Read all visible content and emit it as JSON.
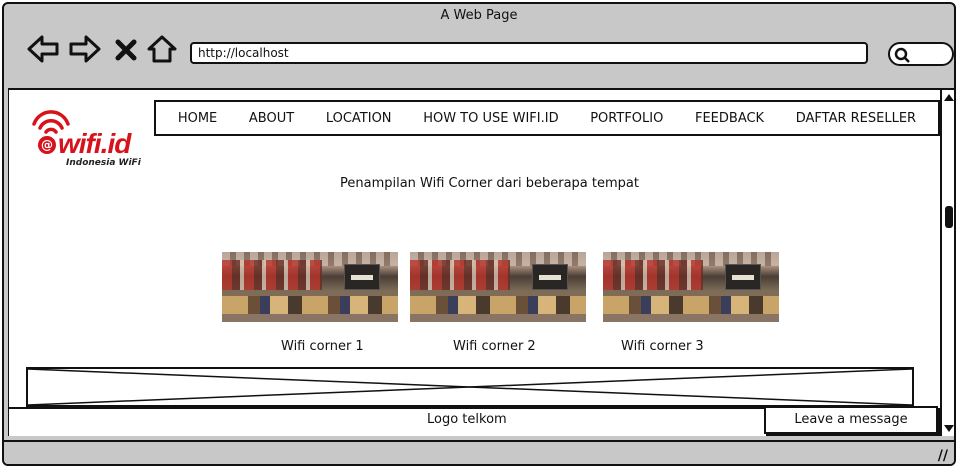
{
  "window": {
    "title": "A Web Page"
  },
  "browser": {
    "url": "http://localhost",
    "icons": [
      "back-icon",
      "forward-icon",
      "stop-icon",
      "home-icon",
      "search-icon"
    ]
  },
  "logo": {
    "brand": "wifi.id",
    "tagline": "Indonesia WiFi",
    "color": "#d8121a"
  },
  "menu": {
    "items": [
      "HOME",
      "ABOUT",
      "LOCATION",
      "HOW TO USE WIFI.ID",
      "PORTFOLIO",
      "FEEDBACK",
      "DAFTAR RESELLER"
    ]
  },
  "main": {
    "heading": "Penampilan Wifi Corner dari beberapa tempat",
    "gallery": [
      {
        "caption": "Wifi corner 1"
      },
      {
        "caption": "Wifi corner 2"
      },
      {
        "caption": "Wifi corner 3"
      }
    ]
  },
  "footer": {
    "logo_label": "Logo telkom",
    "message_button": "Leave a message"
  }
}
